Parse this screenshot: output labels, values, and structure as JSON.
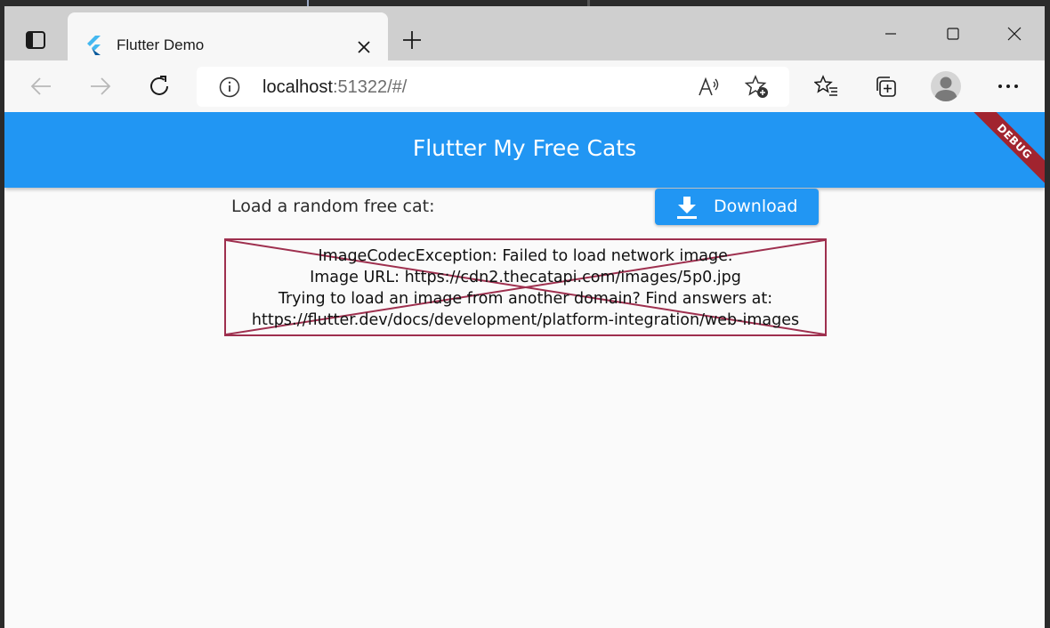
{
  "browser": {
    "tab": {
      "title": "Flutter Demo"
    },
    "address": {
      "host": "localhost",
      "rest": ":51322/#/"
    }
  },
  "app": {
    "title": "Flutter My Free Cats",
    "debug_banner": "DEBUG",
    "prompt": "Load a random free cat:",
    "download_label": "Download",
    "error_lines": [
      "ImageCodecException: Failed to load network image.",
      "Image URL: https://cdn2.thecatapi.com/images/5p0.jpg",
      "Trying to load an image from another domain? Find answers at:",
      "https://flutter.dev/docs/development/platform-integration/web-images"
    ]
  },
  "colors": {
    "app_bar": "#2196f3",
    "debug_ribbon": "#a1242f",
    "error_border": "#9e2f4e"
  },
  "icons": {
    "tab_actions": "tab-actions-icon",
    "favicon": "flutter-logo-icon",
    "close": "close-icon",
    "new_tab": "plus-icon",
    "back": "back-arrow-icon",
    "forward": "forward-arrow-icon",
    "refresh": "refresh-icon",
    "info": "info-icon",
    "read_aloud": "read-aloud-icon",
    "add_favorite": "add-favorite-icon",
    "favorites": "favorites-icon",
    "collections": "collections-icon",
    "profile": "profile-icon",
    "menu": "more-icon",
    "download": "download-icon"
  }
}
